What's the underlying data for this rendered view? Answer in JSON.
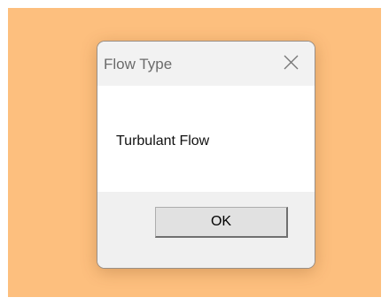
{
  "window": {
    "title": "Flow Type",
    "close_icon": "close-icon"
  },
  "message": {
    "text": "Turbulant Flow"
  },
  "buttons": {
    "ok_label": "OK"
  },
  "colors": {
    "desktop_background": "#FDBF7E",
    "dialog_background": "#F0F0F0",
    "content_background": "#FFFFFF",
    "button_face": "#E1E1E1"
  }
}
